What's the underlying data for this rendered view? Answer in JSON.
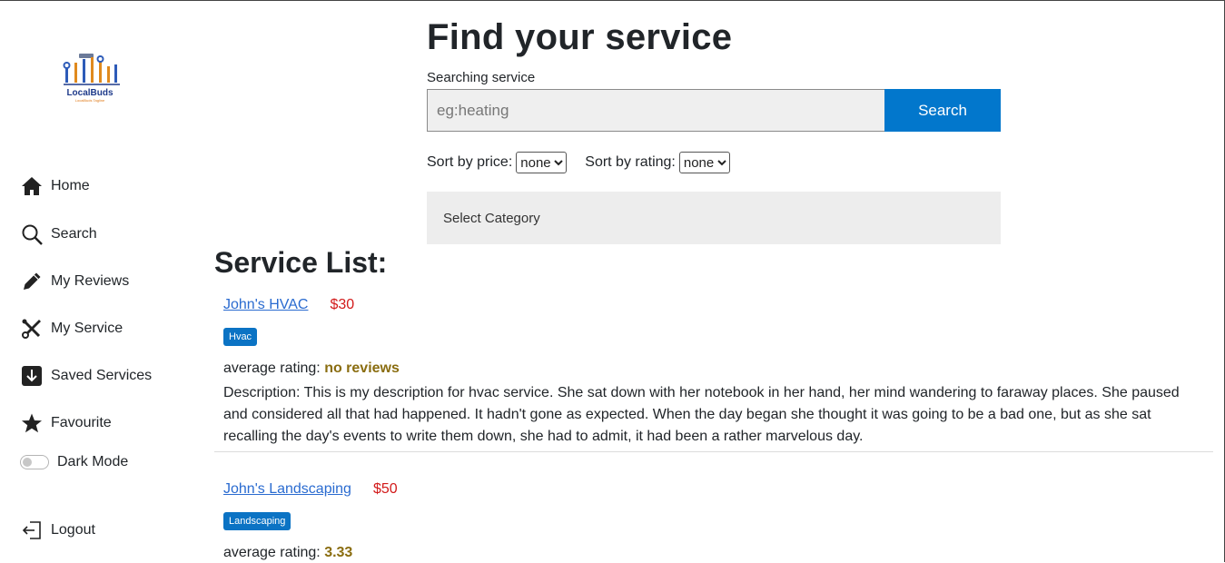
{
  "logo": {
    "name": "LocalBuds",
    "tagline": "LocalBuds Tagline"
  },
  "sidebar": {
    "items": [
      {
        "label": "Home",
        "icon": "home-icon"
      },
      {
        "label": "Search",
        "icon": "search-icon"
      },
      {
        "label": "My Reviews",
        "icon": "pencil-icon"
      },
      {
        "label": "My Service",
        "icon": "tools-icon"
      },
      {
        "label": "Saved Services",
        "icon": "download-box-icon"
      },
      {
        "label": "Favourite",
        "icon": "star-icon"
      }
    ],
    "dark_mode_label": "Dark Mode",
    "logout_label": "Logout"
  },
  "search": {
    "title": "Find your service",
    "label": "Searching service",
    "placeholder": "eg:heating",
    "button": "Search",
    "sort_price_label": "Sort by price:",
    "sort_price_value": "none",
    "sort_rating_label": "Sort by rating:",
    "sort_rating_value": "none",
    "category_label": "Select Category"
  },
  "list": {
    "title": "Service List:",
    "rating_label": "average rating:",
    "services": [
      {
        "name": "John's HVAC",
        "price": "$30",
        "tag": "Hvac",
        "rating": "no reviews",
        "description": "Description: This is my description for hvac service. She sat down with her notebook in her hand, her mind wandering to faraway places. She paused and considered all that had happened. It hadn't gone as expected. When the day began she thought it was going to be a bad one, but as she sat recalling the day's events to write them down, she had to admit, it had been a rather marvelous day."
      },
      {
        "name": "John's Landscaping",
        "price": "$50",
        "tag": "Landscaping",
        "rating": "3.33"
      }
    ]
  },
  "colors": {
    "accent": "#0277cc",
    "price": "#d21a1a",
    "rating": "#8a6d10",
    "link": "#2a6bd0"
  }
}
